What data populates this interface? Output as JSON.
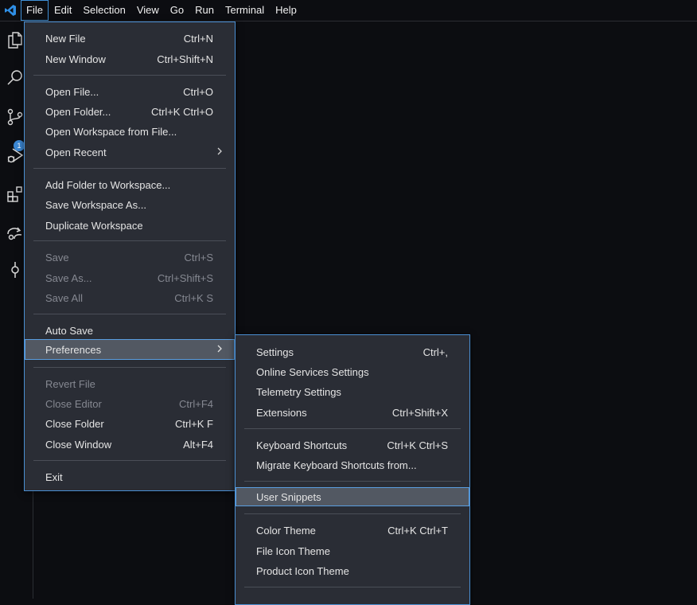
{
  "colors": {
    "accent": "#4a8fd3",
    "menu_bg": "#2a2d35",
    "app_bg": "#0c0d11",
    "badge": "#3c88d4"
  },
  "menubar": {
    "items": [
      "File",
      "Edit",
      "Selection",
      "View",
      "Go",
      "Run",
      "Terminal",
      "Help"
    ]
  },
  "activity": {
    "icons": [
      "explorer-icon",
      "search-icon",
      "source-control-icon",
      "run-debug-icon",
      "extensions-icon",
      "remote-icon",
      "timeline-icon"
    ],
    "scm_badge": "1"
  },
  "file_menu": {
    "new_file": {
      "label": "New File",
      "kb": "Ctrl+N"
    },
    "new_window": {
      "label": "New Window",
      "kb": "Ctrl+Shift+N"
    },
    "open_file": {
      "label": "Open File...",
      "kb": "Ctrl+O"
    },
    "open_folder": {
      "label": "Open Folder...",
      "kb": "Ctrl+K Ctrl+O"
    },
    "open_workspace": {
      "label": "Open Workspace from File..."
    },
    "open_recent": {
      "label": "Open Recent"
    },
    "add_folder": {
      "label": "Add Folder to Workspace..."
    },
    "save_workspace_as": {
      "label": "Save Workspace As..."
    },
    "duplicate_workspace": {
      "label": "Duplicate Workspace"
    },
    "save": {
      "label": "Save",
      "kb": "Ctrl+S"
    },
    "save_as": {
      "label": "Save As...",
      "kb": "Ctrl+Shift+S"
    },
    "save_all": {
      "label": "Save All",
      "kb": "Ctrl+K S"
    },
    "auto_save": {
      "label": "Auto Save"
    },
    "preferences": {
      "label": "Preferences"
    },
    "revert_file": {
      "label": "Revert File"
    },
    "close_editor": {
      "label": "Close Editor",
      "kb": "Ctrl+F4"
    },
    "close_folder": {
      "label": "Close Folder",
      "kb": "Ctrl+K F"
    },
    "close_window": {
      "label": "Close Window",
      "kb": "Alt+F4"
    },
    "exit": {
      "label": "Exit"
    }
  },
  "pref_menu": {
    "settings": {
      "label": "Settings",
      "kb": "Ctrl+,"
    },
    "online_services": {
      "label": "Online Services Settings"
    },
    "telemetry": {
      "label": "Telemetry Settings"
    },
    "extensions": {
      "label": "Extensions",
      "kb": "Ctrl+Shift+X"
    },
    "keyboard_shortcuts": {
      "label": "Keyboard Shortcuts",
      "kb": "Ctrl+K Ctrl+S"
    },
    "migrate_shortcuts": {
      "label": "Migrate Keyboard Shortcuts from..."
    },
    "user_snippets": {
      "label": "User Snippets"
    },
    "color_theme": {
      "label": "Color Theme",
      "kb": "Ctrl+K Ctrl+T"
    },
    "file_icon_theme": {
      "label": "File Icon Theme"
    },
    "product_icon_theme": {
      "label": "Product Icon Theme"
    }
  }
}
